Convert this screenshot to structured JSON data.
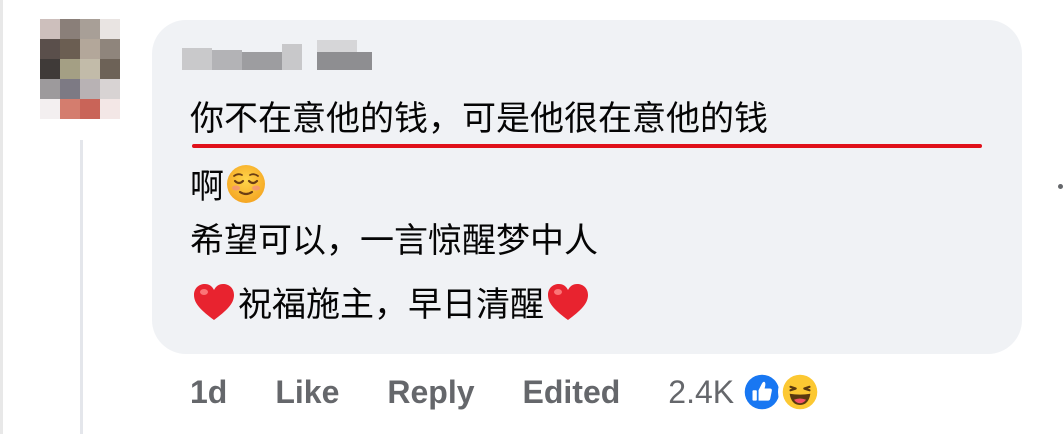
{
  "comment": {
    "lines": [
      "你不在意他的钱，可是他很在意他的钱",
      "啊",
      "希望可以，一言惊醒梦中人",
      "祝福施主，早日清醒"
    ],
    "emojis": [
      "relieved-face",
      "red-heart",
      "red-heart"
    ]
  },
  "footer": {
    "time": "1d",
    "like_label": "Like",
    "reply_label": "Reply",
    "edited_label": "Edited",
    "reaction_count": "2.4K",
    "reactions": [
      "like-icon",
      "haha-icon"
    ]
  },
  "colors": {
    "bubble": "#f0f2f5",
    "underline": "#e0101a",
    "meta_text": "#65676b",
    "like_blue": "#1877f2"
  }
}
